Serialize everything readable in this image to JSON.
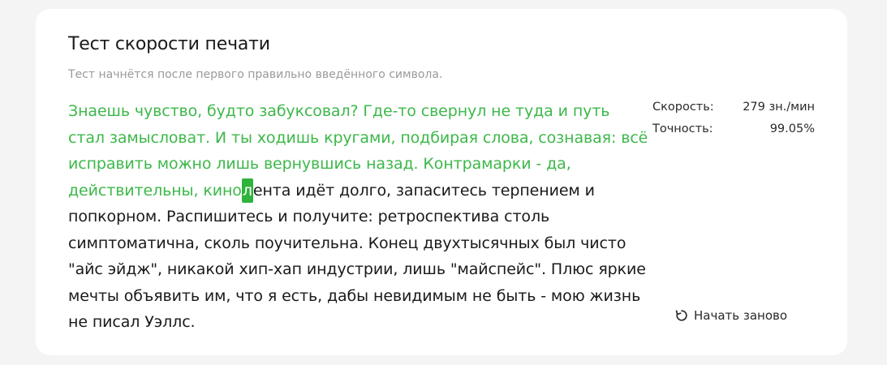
{
  "title": "Тест скорости печати",
  "subtitle": "Тест начнётся после первого правильно введённого символа.",
  "text": {
    "typed": "Знаешь чувство, будто забуксовал? Где-то свернул не туда и путь стал замысловат. И ты ходишь кругами, подбирая слова, сознавая: всё исправить можно лишь вернувшись назад. Контрамарки - да, действительны, кино",
    "current": "л",
    "remaining": "ента идёт долго, запаситесь терпением и попкорном. Распишитесь и получите: ретроспектива столь симптоматична, сколь поучительна. Конец двухтысячных был чисто \"айс эйдж\", никакой хип-хап индустрии, лишь \"майспейс\". Плюс яркие мечты объявить им, что я есть, дабы невидимым не быть - мою жизнь не писал Уэллс."
  },
  "stats": {
    "speed_label": "Скорость:",
    "speed_value": "279 зн./мин",
    "accuracy_label": "Точность:",
    "accuracy_value": "99.05%"
  },
  "restart": {
    "label": "Начать заново",
    "icon": "restart-icon"
  },
  "colors": {
    "typed": "#3db84a",
    "cursor_bg": "#2fb33c",
    "background": "#f4f4f4",
    "card": "#ffffff"
  }
}
